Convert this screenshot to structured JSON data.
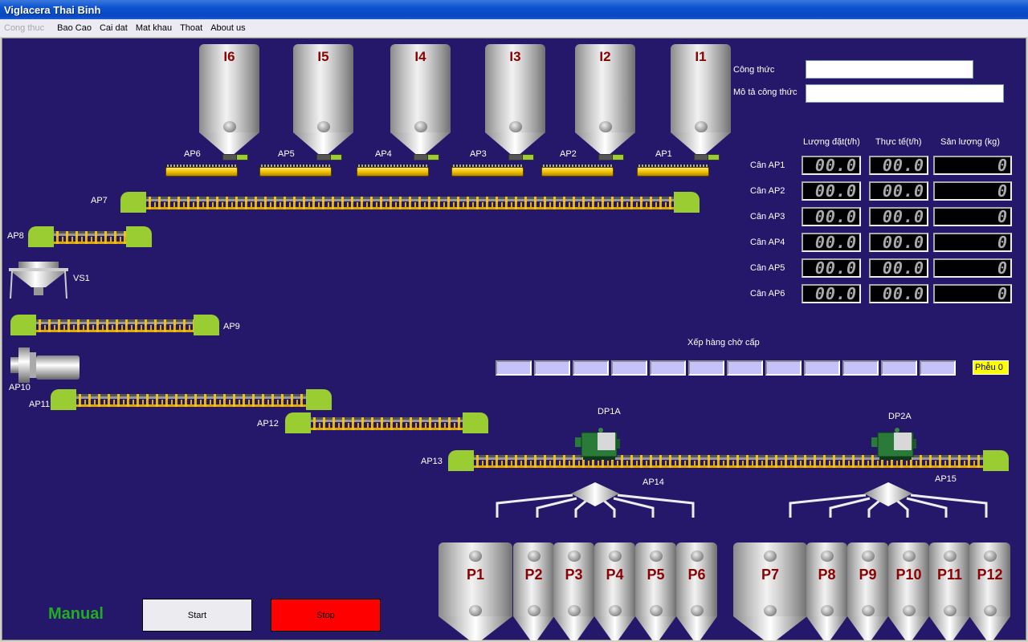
{
  "title": "Viglacera Thai Binh",
  "menu": [
    {
      "label": "Cong thuc",
      "disabled": true
    },
    {
      "label": "Bao Cao"
    },
    {
      "label": "Cai dat"
    },
    {
      "label": "Mat khau"
    },
    {
      "label": "Thoat"
    },
    {
      "label": "About us"
    }
  ],
  "recipe": {
    "label": "Công thức",
    "value": "",
    "desc_label": "Mô tả công thức",
    "desc_value": ""
  },
  "weigh_table": {
    "headers": [
      "Lượng đặt(t/h)",
      "Thực tế(t/h)",
      "Sản lượng (kg)"
    ],
    "rows": [
      {
        "label": "Cân AP1",
        "set": "00.0",
        "actual": "00.0",
        "output": "0"
      },
      {
        "label": "Cân AP2",
        "set": "00.0",
        "actual": "00.0",
        "output": "0"
      },
      {
        "label": "Cân AP3",
        "set": "00.0",
        "actual": "00.0",
        "output": "0"
      },
      {
        "label": "Cân AP4",
        "set": "00.0",
        "actual": "00.0",
        "output": "0"
      },
      {
        "label": "Cân AP5",
        "set": "00.0",
        "actual": "00.0",
        "output": "0"
      },
      {
        "label": "Cân AP6",
        "set": "00.0",
        "actual": "00.0",
        "output": "0"
      }
    ]
  },
  "queue": {
    "label": "Xếp hàng chờ  cấp",
    "slots": [
      "",
      "",
      "",
      "",
      "",
      "",
      "",
      "",
      "",
      "",
      "",
      ""
    ],
    "hopper": "Phễu 0"
  },
  "top_silos": [
    "I6",
    "I5",
    "I4",
    "I3",
    "I2",
    "I1"
  ],
  "feeders": [
    "AP6",
    "AP5",
    "AP4",
    "AP3",
    "AP2",
    "AP1"
  ],
  "equipment": {
    "ap7": "AP7",
    "ap8": "AP8",
    "vs1": "VS1",
    "ap9": "AP9",
    "ap10": "AP10",
    "ap11": "AP11",
    "ap12": "AP12",
    "ap13": "AP13",
    "dp1a": "DP1A",
    "dp2a": "DP2A",
    "ap14": "AP14",
    "ap15": "AP15"
  },
  "bottom_silos": [
    "P1",
    "P2",
    "P3",
    "P4",
    "P5",
    "P6",
    "P7",
    "P8",
    "P9",
    "P10",
    "P11",
    "P12"
  ],
  "mode": "Manual",
  "buttons": {
    "start": "Start",
    "stop": "Stop"
  },
  "colors": {
    "background": "#25186b",
    "end_cap": "#9acd32",
    "stop": "#ff0000",
    "mode": "#1fae1f",
    "silo_label": "#8b0000"
  }
}
